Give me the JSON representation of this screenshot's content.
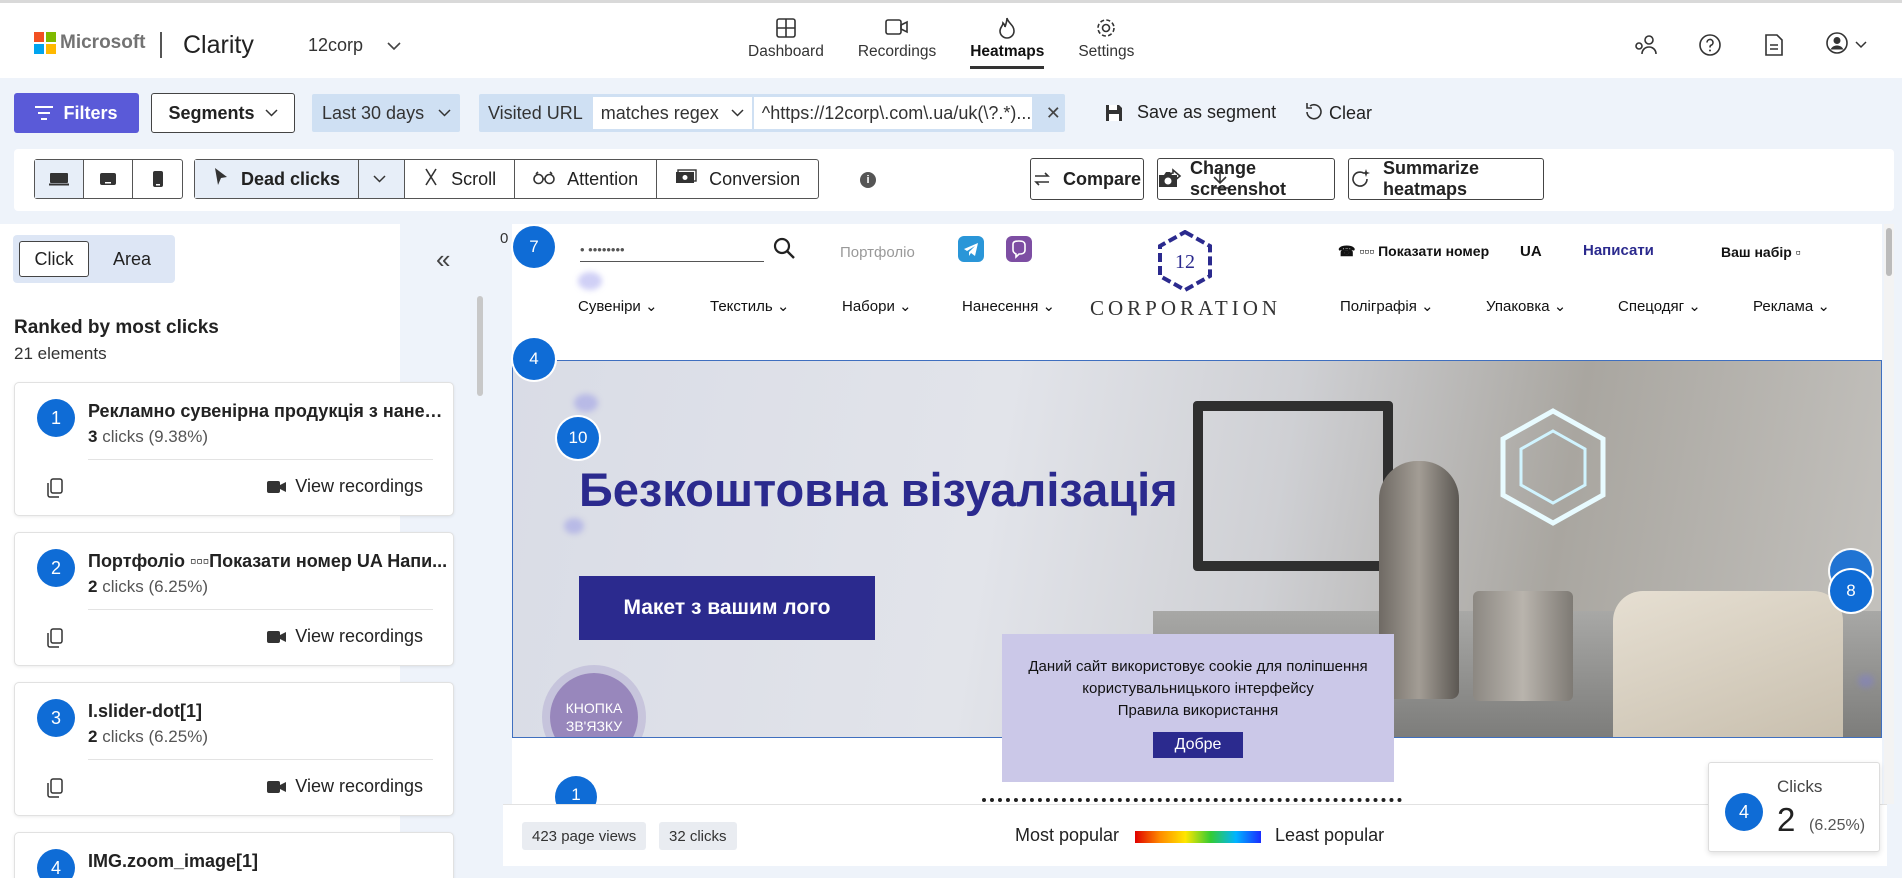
{
  "brand": {
    "company": "Microsoft",
    "product": "Clarity",
    "project": "12corp"
  },
  "nav": {
    "tabs": [
      {
        "label": "Dashboard",
        "icon": "dashboard-icon"
      },
      {
        "label": "Recordings",
        "icon": "video-icon"
      },
      {
        "label": "Heatmaps",
        "icon": "flame-icon",
        "active": true
      },
      {
        "label": "Settings",
        "icon": "gear-icon"
      }
    ]
  },
  "filters": {
    "filters_label": "Filters",
    "segments_label": "Segments",
    "date_range": "Last 30 days",
    "url_filter": {
      "label": "Visited URL",
      "operator": "matches regex",
      "value": "^https://12corp\\.com\\.ua/uk(\\?.*)...",
      "remove": "✕"
    },
    "save_segment": "Save as segment",
    "clear": "Clear"
  },
  "toolbar": {
    "modes": [
      "Dead clicks",
      "Scroll",
      "Attention",
      "Conversion"
    ],
    "selected_mode": "Dead clicks",
    "info": "i",
    "compare": "Compare",
    "change_screenshot": "Change screenshot",
    "summarize": "Summarize heatmaps"
  },
  "left_panel": {
    "tabs": [
      "Click",
      "Area"
    ],
    "selected_tab": "Click",
    "collapse": "«",
    "title": "Ranked by most clicks",
    "count": "21 elements",
    "view_recordings": "View recordings",
    "items": [
      {
        "rank": "1",
        "title": "Рекламно сувенірна продукція з нанесе...",
        "clicks": "3",
        "rest": " clicks (9.38%)"
      },
      {
        "rank": "2",
        "title": "Портфоліо ▫▫▫Показати номер UA Напи...",
        "clicks": "2",
        "rest": " clicks (6.25%)"
      },
      {
        "rank": "3",
        "title": "I.slider-dot[1]",
        "clicks": "2",
        "rest": " clicks (6.25%)"
      },
      {
        "rank": "4",
        "title": "IMG.zoom_image[1]",
        "clicks": "",
        "rest": ""
      }
    ]
  },
  "site": {
    "zero": "0",
    "search_placeholder": "• ••••••••",
    "portfolio": "Портфоліо",
    "logo_number": "12",
    "logo_text": "CORPORATION",
    "phone": "☎ ▫▫▫ Показати номер",
    "lang": "UA",
    "write": "Написати",
    "cart": "Ваш набір ▫",
    "menu": [
      "Сувеніри",
      "Текстиль",
      "Набори",
      "Нанесення",
      "Поліграфія",
      "Упаковка",
      "Спецодяг",
      "Реклама"
    ],
    "banner_title": "Безкоштовна візуалізація",
    "banner_button": "Макет з вашим лого",
    "contact": "КНОПКА\nЗВ'ЯЗКУ",
    "cookie_line1": "Даний сайт використовує cookie для поліпшення",
    "cookie_line2": "користувальницького інтерфейсу",
    "cookie_line3": "Правила використання",
    "cookie_ok": "Добре"
  },
  "badges": [
    "7",
    "4",
    "10",
    "8",
    "1"
  ],
  "bottom": {
    "page_views": "423 page views",
    "clicks": "32 clicks",
    "most": "Most popular",
    "least": "Least popular"
  },
  "tooltip": {
    "label": "Clicks",
    "rank": "4",
    "value": "2",
    "pct": "(6.25%)"
  },
  "colors": {
    "accent": "#5a5ad8",
    "badge": "#0f6cd6",
    "site_brand": "#2b2a8e"
  }
}
